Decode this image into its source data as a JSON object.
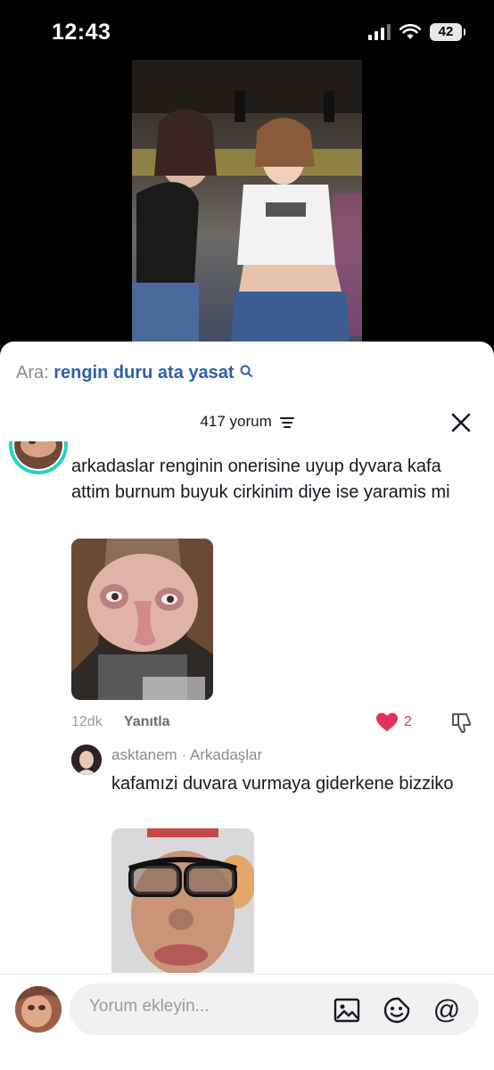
{
  "status_bar": {
    "time": "12:43",
    "battery": "42"
  },
  "search": {
    "label": "Ara:",
    "query": "rengin duru ata yasat"
  },
  "comments_header": {
    "count_label": "417 yorum"
  },
  "comment": {
    "text": "arkadaslar renginin onerisine uyup dyvara kafa attim burnum buyuk cirkinim diye ise yaramis mi",
    "time_ago": "12dk",
    "reply_label": "Yanıtla",
    "like_count": "2",
    "liked": true
  },
  "reply": {
    "username": "asktanem",
    "separator": "·",
    "relation": "Arkadaşlar",
    "text": "kafamızi duvara vurmaya giderkene bizziko"
  },
  "composer": {
    "placeholder": "Yorum ekleyin..."
  },
  "colors": {
    "search_query": "#2f5fae",
    "like_red": "#e1335a",
    "story_ring": "#20d5c4"
  },
  "icons": [
    "search-icon",
    "filter-icon",
    "close-icon",
    "heart-icon",
    "dislike-icon",
    "image-icon",
    "sticker-icon",
    "mention-icon"
  ]
}
